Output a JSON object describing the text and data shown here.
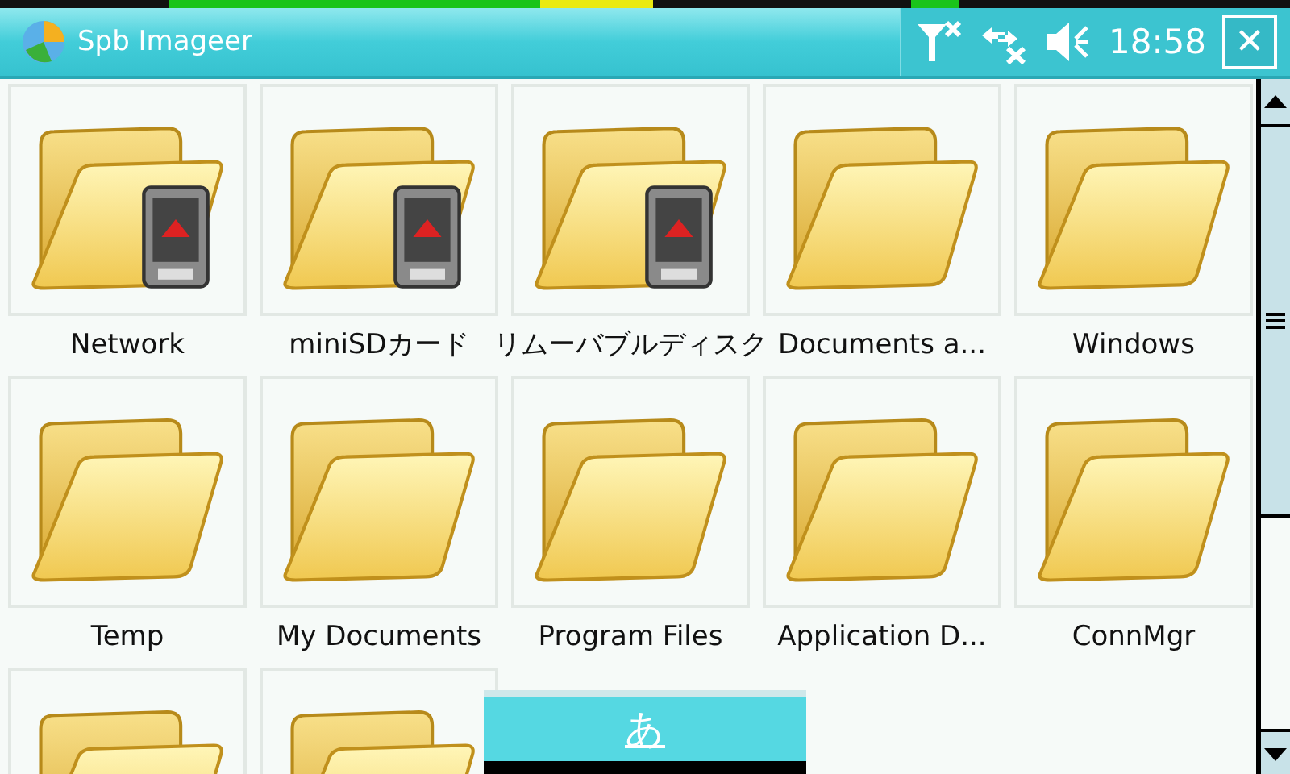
{
  "title_bar": {
    "app_title": "Spb Imageer",
    "time": "18:58",
    "close_label": "✕"
  },
  "items": [
    {
      "label": "Network",
      "kind": "storage"
    },
    {
      "label": "miniSDカード",
      "kind": "storage"
    },
    {
      "label": "リムーバブルディスク",
      "kind": "storage"
    },
    {
      "label": "Documents a...",
      "kind": "folder"
    },
    {
      "label": "Windows",
      "kind": "folder"
    },
    {
      "label": "Temp",
      "kind": "folder"
    },
    {
      "label": "My Documents",
      "kind": "folder"
    },
    {
      "label": "Program Files",
      "kind": "folder"
    },
    {
      "label": "Application D...",
      "kind": "folder"
    },
    {
      "label": "ConnMgr",
      "kind": "folder"
    },
    {
      "kind": "folder"
    },
    {
      "kind": "folder"
    }
  ],
  "input_panel": {
    "label": "あ"
  }
}
